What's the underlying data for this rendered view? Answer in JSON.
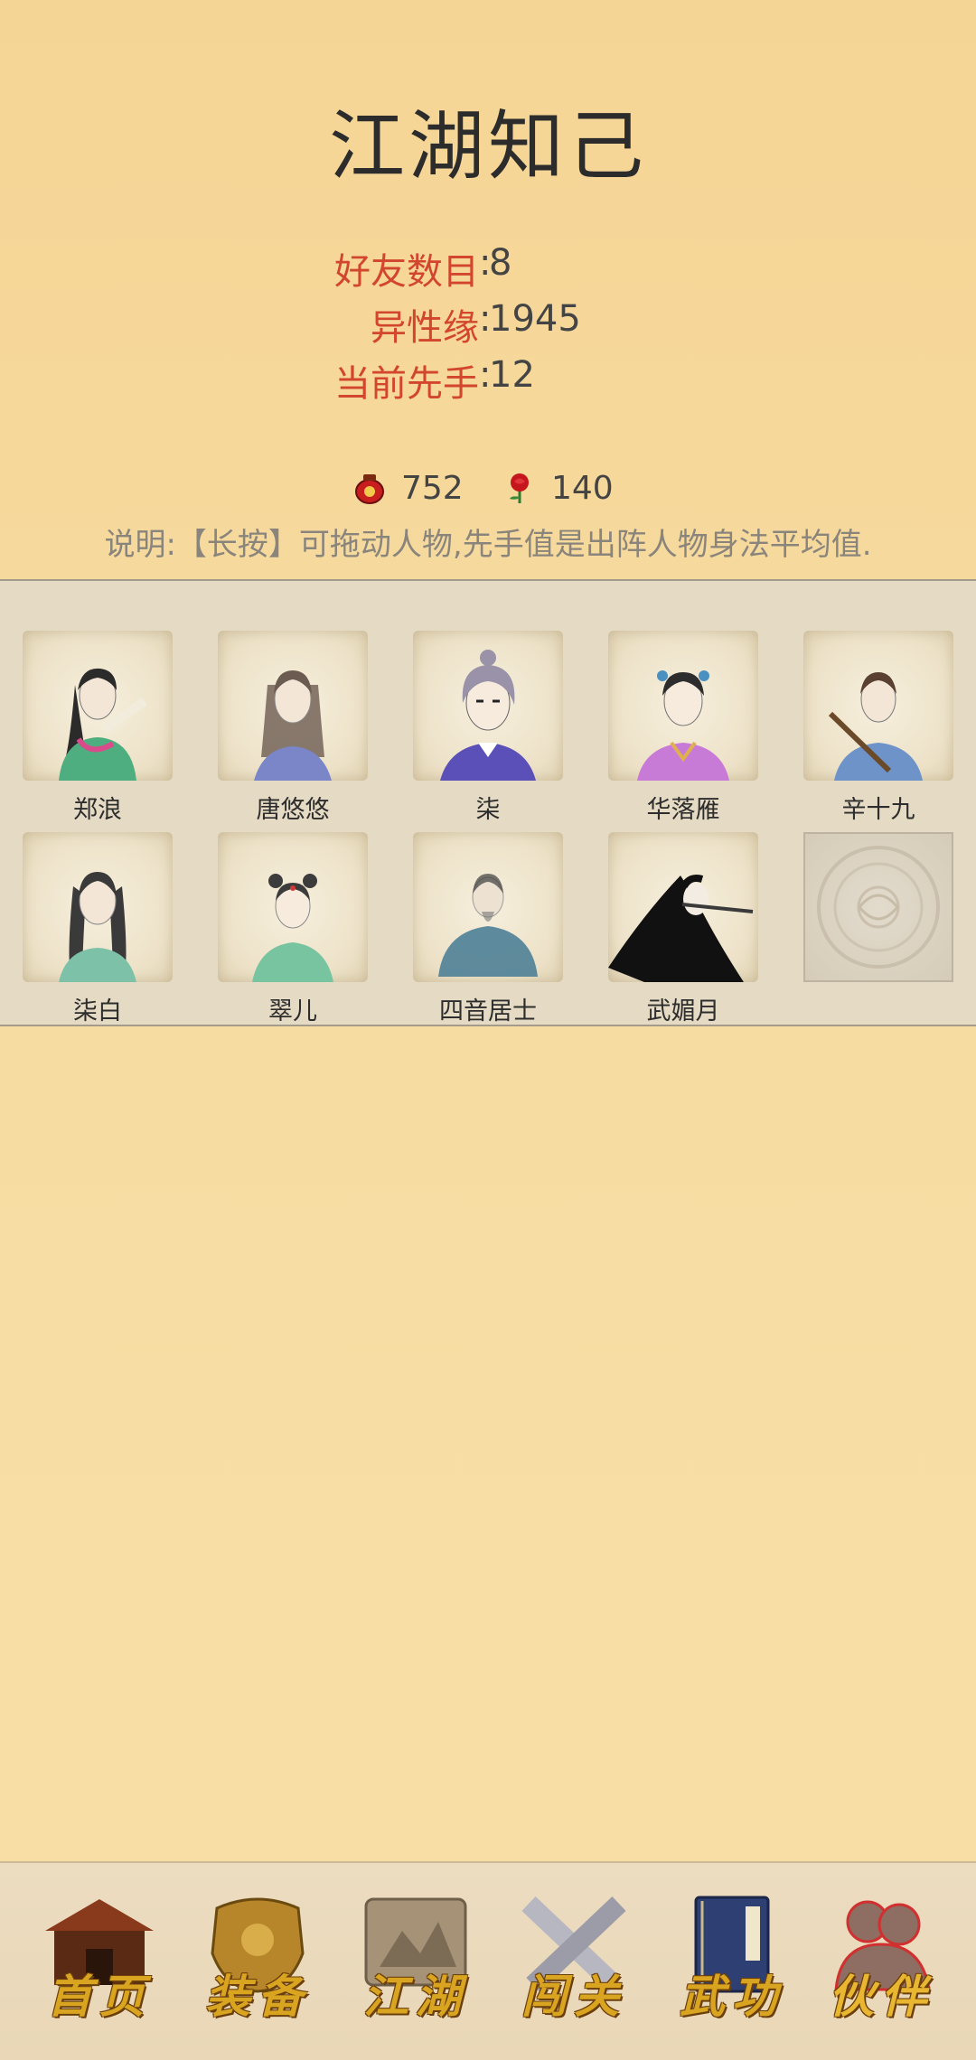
{
  "page": {
    "title": "江湖知己"
  },
  "stats": [
    {
      "key": "好友数目",
      "value": "8"
    },
    {
      "key": "异性缘",
      "value": "1945"
    },
    {
      "key": "当前先手",
      "value": "12"
    }
  ],
  "currency": {
    "wine": {
      "icon": "wine-jar-icon",
      "value": "752"
    },
    "rose": {
      "icon": "rose-icon",
      "value": "140"
    }
  },
  "notice": "说明:【长按】可拖动人物,先手值是出阵人物身法平均值.",
  "companions": [
    {
      "name": "郑浪",
      "robe": "#4fae7f",
      "hair": "#2b2b2b"
    },
    {
      "name": "唐悠悠",
      "robe": "#7a86c8",
      "hair": "#6b5b50"
    },
    {
      "name": "柒",
      "robe": "#5b4fb8",
      "hair": "#9a92a8"
    },
    {
      "name": "华落雁",
      "robe": "#c77bd6",
      "hair": "#2d2d2d"
    },
    {
      "name": "辛十九",
      "robe": "#6d93c9",
      "hair": "#5a4030"
    },
    {
      "name": "柒白",
      "robe": "#7dc2a8",
      "hair": "#3a3a3a"
    },
    {
      "name": "翠儿",
      "robe": "#79c4a0",
      "hair": "#3c3c3c"
    },
    {
      "name": "四音居士",
      "robe": "#4e7f97",
      "hair": "#3c3c3c"
    },
    {
      "name": "武媚月",
      "robe": "#1e1e1e",
      "hair": "#111111"
    }
  ],
  "nav": [
    {
      "label": "首页",
      "icon": "house-icon",
      "active": false
    },
    {
      "label": "装备",
      "icon": "armor-icon",
      "active": false
    },
    {
      "label": "江湖",
      "icon": "map-scroll-icon",
      "active": false
    },
    {
      "label": "闯关",
      "icon": "crossed-swords-icon",
      "active": false
    },
    {
      "label": "武功",
      "icon": "book-icon",
      "active": false
    },
    {
      "label": "伙伴",
      "icon": "companions-icon",
      "active": true
    }
  ]
}
